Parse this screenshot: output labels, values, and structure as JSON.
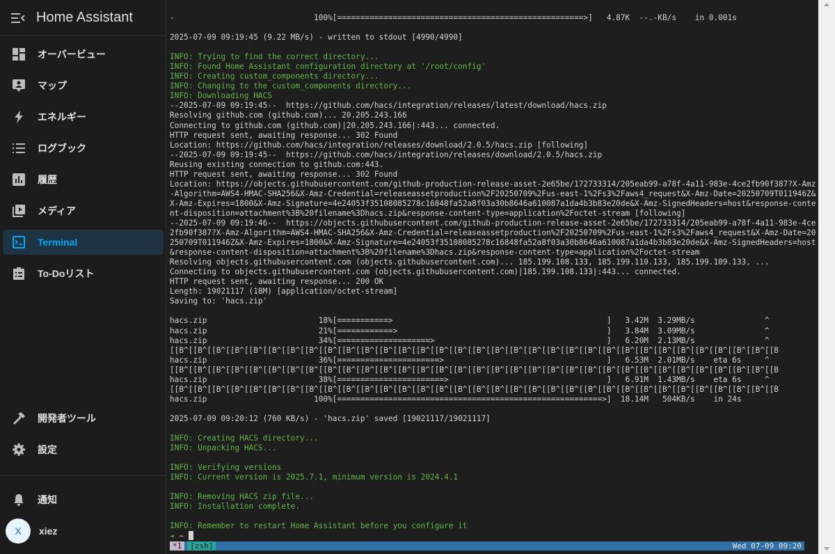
{
  "app": {
    "title": "Home Assistant"
  },
  "sidebar": {
    "items": [
      {
        "label": "オーバービュー",
        "icon": "dashboard-icon"
      },
      {
        "label": "マップ",
        "icon": "map-account-icon"
      },
      {
        "label": "エネルギー",
        "icon": "lightning-icon"
      },
      {
        "label": "ログブック",
        "icon": "list-icon"
      },
      {
        "label": "履歴",
        "icon": "chart-box-icon"
      },
      {
        "label": "メディア",
        "icon": "play-box-icon"
      },
      {
        "label": "Terminal",
        "icon": "console-icon",
        "active": true
      },
      {
        "label": "To-Doリスト",
        "icon": "clipboard-list-icon"
      }
    ],
    "bottom_items": [
      {
        "label": "開発者ツール",
        "icon": "hammer-icon"
      },
      {
        "label": "設定",
        "icon": "gear-icon"
      }
    ],
    "notifications": {
      "label": "通知",
      "icon": "bell-icon"
    },
    "user": {
      "initial": "X",
      "name": "xiez"
    }
  },
  "terminal": {
    "lines": [
      {
        "t": "-                              100%[=====================================================>]   4.87K  --.-KB/s    in 0.001s"
      },
      {
        "t": ""
      },
      {
        "t": "2025-07-09 09:19:45 (9.22 MB/s) - written to stdout [4990/4990]"
      },
      {
        "t": ""
      },
      {
        "t": "INFO: Trying to find the correct directory...",
        "c": "info"
      },
      {
        "t": "INFO: Found Home Assistant configuration directory at '/root/config'",
        "c": "info"
      },
      {
        "t": "INFO: Creating custom_components directory...",
        "c": "info"
      },
      {
        "t": "INFO: Changing to the custom_components directory...",
        "c": "info"
      },
      {
        "t": "INFO: Downloading HACS",
        "c": "info"
      },
      {
        "t": "--2025-07-09 09:19:45--  https://github.com/hacs/integration/releases/latest/download/hacs.zip"
      },
      {
        "t": "Resolving github.com (github.com)... 20.205.243.166"
      },
      {
        "t": "Connecting to github.com (github.com)|20.205.243.166|:443... connected."
      },
      {
        "t": "HTTP request sent, awaiting response... 302 Found"
      },
      {
        "t": "Location: https://github.com/hacs/integration/releases/download/2.0.5/hacs.zip [following]"
      },
      {
        "t": "--2025-07-09 09:19:45--  https://github.com/hacs/integration/releases/download/2.0.5/hacs.zip"
      },
      {
        "t": "Reusing existing connection to github.com:443."
      },
      {
        "t": "HTTP request sent, awaiting response... 302 Found"
      },
      {
        "t": "Location: https://objects.githubusercontent.com/github-production-release-asset-2e65be/172733314/205eab99-a78f-4a11-983e-4ce2fb90f387?X-Amz"
      },
      {
        "t": "-Algorithm=AWS4-HMAC-SHA256&X-Amz-Credential=releaseassetproduction%2F20250709%2Fus-east-1%2Fs3%2Faws4_request&X-Amz-Date=20250709T011946Z&"
      },
      {
        "t": "X-Amz-Expires=1800&X-Amz-Signature=4e24053f35108085278c16848fa52a8f03a30b8646a610087a1da4b3b83e20de&X-Amz-SignedHeaders=host&response-conte"
      },
      {
        "t": "nt-disposition=attachment%3B%20filename%3Dhacs.zip&response-content-type=application%2Foctet-stream [following]"
      },
      {
        "t": "--2025-07-09 09:19:46--  https://objects.githubusercontent.com/github-production-release-asset-2e65be/172733314/205eab99-a78f-4a11-983e-4ce"
      },
      {
        "t": "2fb90f387?X-Amz-Algorithm=AWS4-HMAC-SHA256&X-Amz-Credential=releaseassetproduction%2F20250709%2Fus-east-1%2Fs3%2Faws4_request&X-Amz-Date=20"
      },
      {
        "t": "250709T011946Z&X-Amz-Expires=1800&X-Amz-Signature=4e24053f35108085278c16848fa52a8f03a30b8646a610087a1da4b3b83e20de&X-Amz-SignedHeaders=host"
      },
      {
        "t": "&response-content-disposition=attachment%3B%20filename%3Dhacs.zip&response-content-type=application%2Foctet-stream"
      },
      {
        "t": "Resolving objects.githubusercontent.com (objects.githubusercontent.com)... 185.199.108.133, 185.199.110.133, 185.199.109.133, ..."
      },
      {
        "t": "Connecting to objects.githubusercontent.com (objects.githubusercontent.com)|185.199.108.133|:443... connected."
      },
      {
        "t": "HTTP request sent, awaiting response... 200 OK"
      },
      {
        "t": "Length: 19021117 (18M) [application/octet-stream]"
      },
      {
        "t": "Saving to: 'hacs.zip'"
      },
      {
        "t": ""
      },
      {
        "t": "hacs.zip                        18%[===========>                                              ]   3.42M  3.29MB/s               ^"
      },
      {
        "t": "hacs.zip                        21%[============>                                             ]   3.84M  3.09MB/s               ^"
      },
      {
        "t": "hacs.zip                        34%[====================>                                     ]   6.20M  2.13MB/s               ^"
      },
      {
        "t": "[[B^[[B^[[B^[[B^[[B^[[B^[[B^[[B^[[B^[[B^[[B^[[B^[[B^[[B^[[B^[[B^[[B^[[B^[[B^[[B^[[B^[[B^[[B^[[B^[[B^[[B^[[B^[[B^[[B^[[B^[[B^[[B^[[B"
      },
      {
        "t": "hacs.zip                        36%[======================>                                   ]   6.53M  2.01MB/s    eta 6s     ^"
      },
      {
        "t": "[[B^[[B^[[B^[[B^[[B^[[B^[[B^[[B^[[B^[[B^[[B^[[B^[[B^[[B^[[B^[[B^[[B^[[B^[[B^[[B^[[B^[[B^[[B^[[B^[[B^[[B^[[B^[[B^[[B^[[B^[[B^[[B^[[B"
      },
      {
        "t": "hacs.zip                        38%[=======================>                                  ]   6.91M  1.43MB/s    eta 6s     ^"
      },
      {
        "t": "[[B^[[B^[[B^[[B^[[B^[[B^[[B^[[B^[[B^[[B^[[B^[[B^[[B^[[B^[[B^[[B^[[B^[[B^[[B^[[B^[[B^[[B^[[B^[[B^[[B^[[B^[[B^[[B^[[B^[[B^[[B^[[B^[[B"
      },
      {
        "t": "hacs.zip                       100%[=========================================================>]  18.14M   504KB/s    in 24s"
      },
      {
        "t": ""
      },
      {
        "t": "2025-07-09 09:20:12 (760 KB/s) - 'hacs.zip' saved [19021117/19021117]"
      },
      {
        "t": ""
      },
      {
        "t": "INFO: Creating HACS directory...",
        "c": "info"
      },
      {
        "t": "INFO: Unpacking HACS...",
        "c": "info"
      },
      {
        "t": ""
      },
      {
        "t": "INFO: Verifying versions",
        "c": "info"
      },
      {
        "t": "INFO: Current version is 2025.7.1, minimum version is 2024.4.1",
        "c": "info"
      },
      {
        "t": ""
      },
      {
        "t": "INFO: Removing HACS zip file...",
        "c": "info"
      },
      {
        "t": "INFO: Installation complete.",
        "c": "info"
      },
      {
        "t": ""
      },
      {
        "t": "INFO: Remember to restart Home Assistant before you configure it",
        "c": "info"
      }
    ],
    "prompt": {
      "arrow": "➜",
      "dir": "~"
    },
    "tmux": {
      "window_number": "*1",
      "window_name": "[zsh]",
      "status": "Wed 07-09 09:20"
    }
  }
}
